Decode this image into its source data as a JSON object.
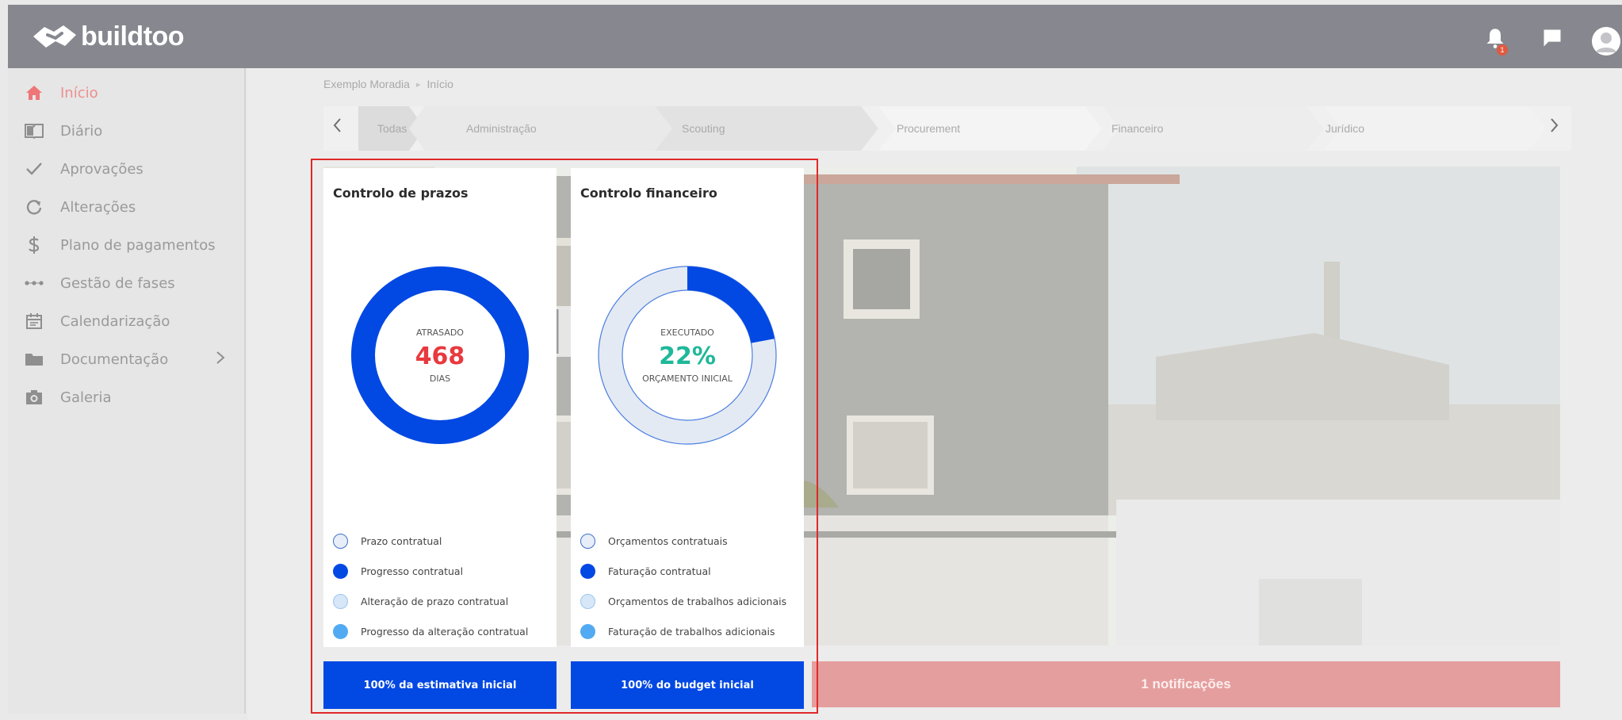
{
  "app": {
    "logo_text": "buildtoo"
  },
  "header": {
    "notification_count": "1",
    "icons": [
      "bell-icon",
      "chat-icon",
      "user-avatar-icon"
    ]
  },
  "sidebar": {
    "items": [
      {
        "label": "Início",
        "icon": "home-icon",
        "active": true
      },
      {
        "label": "Diário",
        "icon": "book-icon"
      },
      {
        "label": "Aprovações",
        "icon": "check-icon"
      },
      {
        "label": "Alterações",
        "icon": "refresh-icon"
      },
      {
        "label": "Plano de pagamentos",
        "icon": "dollar-icon"
      },
      {
        "label": "Gestão de fases",
        "icon": "dots-icon"
      },
      {
        "label": "Calendarização",
        "icon": "calendar-icon"
      },
      {
        "label": "Documentação",
        "icon": "folder-icon",
        "has_submenu": true
      },
      {
        "label": "Galeria",
        "icon": "camera-icon"
      }
    ]
  },
  "breadcrumb": [
    "Exemplo Moradia",
    "Início"
  ],
  "phases": {
    "items": [
      "Todas",
      "Administração",
      "Scouting",
      "Procurement",
      "Financeiro",
      "Jurídico"
    ],
    "selected": "Todas"
  },
  "notifications": {
    "label": "1 notificações"
  },
  "cards": {
    "prazos": {
      "title": "Controlo de prazos",
      "center_top": "ATRASADO",
      "center_value": "468",
      "center_bottom": "DIAS",
      "progress": 1.0,
      "legend": [
        {
          "label": "Prazo contratual"
        },
        {
          "label": "Progresso contratual"
        },
        {
          "label": "Alteração de prazo contratual"
        },
        {
          "label": "Progresso da alteração contratual"
        }
      ],
      "button": "100% da estimativa inicial"
    },
    "financeiro": {
      "title": "Controlo financeiro",
      "center_top": "EXECUTADO",
      "center_value": "22%",
      "center_bottom": "ORÇAMENTO INICIAL",
      "progress": 0.22,
      "legend": [
        {
          "label": "Orçamentos contratuais"
        },
        {
          "label": "Faturação contratual"
        },
        {
          "label": "Orçamentos de trabalhos adicionais"
        },
        {
          "label": "Faturação de trabalhos adicionais"
        }
      ],
      "button": "100% do budget inicial"
    }
  },
  "colors": {
    "accent_blue": "#0248e3",
    "late_red": "#e8393e",
    "exec_teal": "#1fb89a",
    "ring_light": "#e4eaf3",
    "light_blue_dot": "#d7e7f7",
    "mid_blue_dot": "#52abf2"
  }
}
